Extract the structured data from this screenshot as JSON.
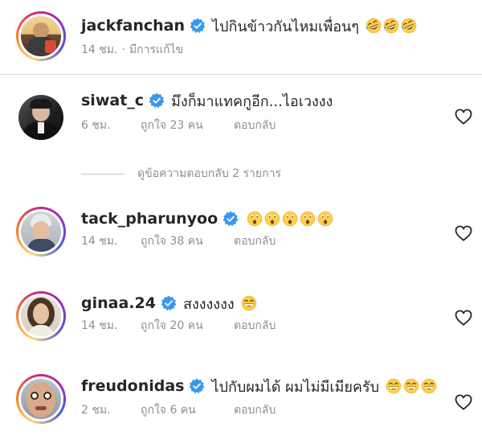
{
  "caption": {
    "username": "jackfanchan",
    "text": "ไปกินข้าวกันไหมเพื่อนๆ",
    "emoji": [
      "rofl",
      "rofl",
      "rofl"
    ],
    "time": "14 ชม.",
    "separator": "·",
    "edited": "มีการแก้ไข"
  },
  "comments": [
    {
      "username": "siwat_c",
      "text": "มึงก็มาแทคกูอีก...ไอเวงงง",
      "emoji": [],
      "time": "6 ชม.",
      "likes": "ถูกใจ 23 คน",
      "reply": "ตอบกลับ"
    },
    {
      "username": "tack_pharunyoo",
      "text": "",
      "emoji": [
        "astonished",
        "astonished",
        "astonished",
        "astonished",
        "astonished"
      ],
      "time": "14 ชม.",
      "likes": "ถูกใจ 38 คน",
      "reply": "ตอบกลับ"
    },
    {
      "username": "ginaa.24",
      "text": "สงงงงงง",
      "emoji": [
        "grin"
      ],
      "time": "14 ชม.",
      "likes": "ถูกใจ 20 คน",
      "reply": "ตอบกลับ"
    },
    {
      "username": "freudonidas",
      "text": "ไปกับผมได้ ผมไม่มีเมียครับ",
      "emoji": [
        "grin",
        "grin",
        "grin"
      ],
      "time": "2 ชม.",
      "likes": "ถูกใจ 6 คน",
      "reply": "ตอบกลับ"
    }
  ],
  "view_replies": "ดูข้อความตอบกลับ 2 รายการ",
  "icons": {
    "verified": "verified-badge-icon",
    "like": "heart-outline-icon"
  },
  "colors": {
    "verified": "#3897f0",
    "text": "#262626",
    "meta": "#8e8e8e"
  }
}
